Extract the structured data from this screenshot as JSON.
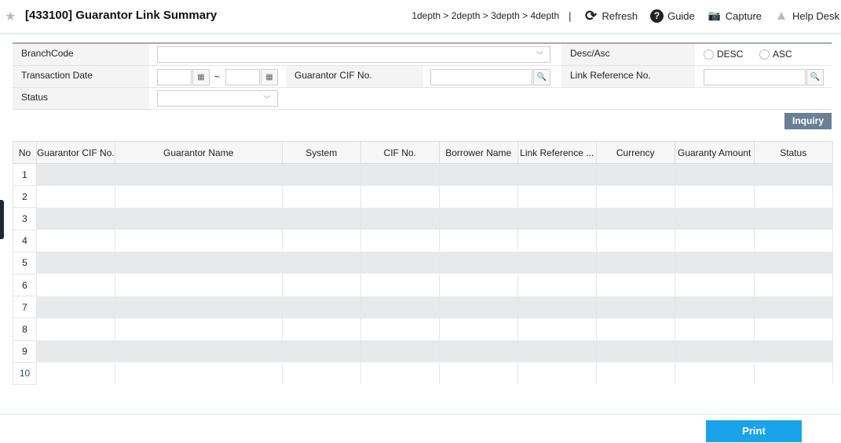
{
  "header": {
    "title": "[433100] Guarantor Link Summary",
    "breadcrumb": "1depth > 2depth > 3depth > 4depth",
    "separator": "|",
    "refresh": "Refresh",
    "guide": "Guide",
    "capture": "Capture",
    "help_desk": "Help Desk"
  },
  "form": {
    "branch_code_label": "BranchCode",
    "branch_code_value": "",
    "desc_asc_label": "Desc/Asc",
    "desc_label": "DESC",
    "asc_label": "ASC",
    "transaction_date_label": "Transaction Date",
    "date_from": "",
    "date_to": "",
    "tilde": "~",
    "guarantor_cif_label": "Guarantor CIF No.",
    "guarantor_cif_value": "",
    "link_ref_label": "Link Reference No.",
    "link_ref_value": "",
    "status_label": "Status",
    "status_value": ""
  },
  "inquiry_label": "Inquiry",
  "table": {
    "columns": [
      "No",
      "Guarantor CIF No.",
      "Guarantor Name",
      "System",
      "CIF No.",
      "Borrower Name",
      "Link Reference ...",
      "Currency",
      "Guaranty Amount",
      "Status"
    ],
    "row_numbers": [
      "1",
      "2",
      "3",
      "4",
      "5",
      "6",
      "7",
      "8",
      "9",
      "10"
    ]
  },
  "print_label": "Print",
  "colors": {
    "inquiry": "#6a7f96",
    "print": "#1aa3e8",
    "row_alt": "#e8e9eb"
  }
}
